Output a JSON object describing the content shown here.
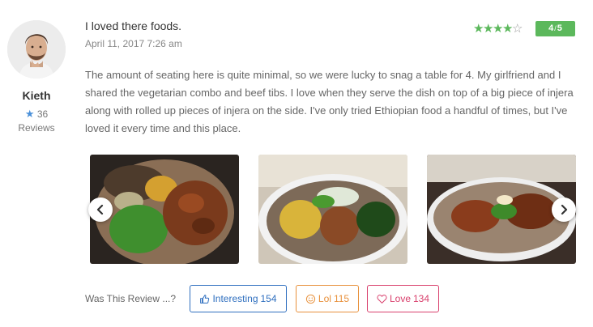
{
  "reviewer": {
    "name": "Kieth",
    "review_count": "36",
    "reviews_label": "Reviews"
  },
  "review": {
    "title": "I loved there foods.",
    "date": "April 11, 2017 7:26 am",
    "rating": {
      "score": "4",
      "max": "5",
      "stars_filled": 4,
      "stars_total": 5
    },
    "body": "The amount of seating here is quite minimal, so we were lucky to snag a table for 4. My girlfriend and I shared the vegetarian combo and beef tibs. I love when they serve the dish on top of a big piece of injera along with rolled up pieces of injera on the side. I've only tried Ethiopian food a handful of times, but I've loved it every time and this place."
  },
  "photos": [
    {
      "name": "food-photo-1"
    },
    {
      "name": "food-photo-2"
    },
    {
      "name": "food-photo-3"
    }
  ],
  "feedback": {
    "prompt": "Was This Review ...?",
    "interesting": {
      "label": "Interesting",
      "count": "154",
      "icon": "thumbs-up-icon",
      "color": "#2f6fbf"
    },
    "lol": {
      "label": "Lol",
      "count": "115",
      "icon": "smile-icon",
      "color": "#e8913c"
    },
    "love": {
      "label": "Love",
      "count": "134",
      "icon": "heart-icon",
      "color": "#d9406d"
    }
  },
  "colors": {
    "rating_green": "#5cb85c",
    "accent_blue": "#4a90d9"
  }
}
